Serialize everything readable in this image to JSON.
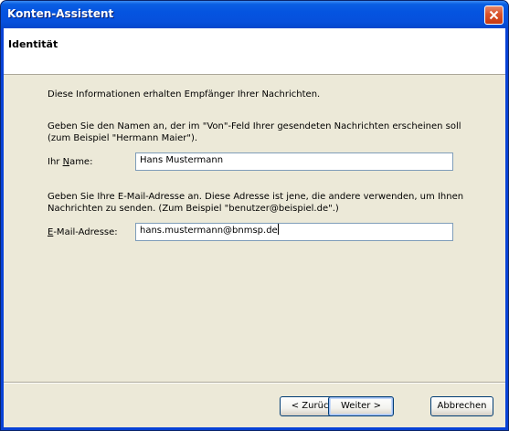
{
  "window": {
    "title": "Konten-Assistent",
    "close_icon": "close-icon"
  },
  "header": {
    "title": "Identität"
  },
  "content": {
    "intro": "Diese Informationen erhalten Empfänger Ihrer Nachrichten.",
    "name_instruction_line1": "Geben Sie den Namen an, der im \"Von\"-Feld Ihrer gesendeten Nachrichten erscheinen soll",
    "name_instruction_line2": "(zum Beispiel \"Hermann Maier\").",
    "name_label_pre": "Ihr ",
    "name_label_accel": "N",
    "name_label_post": "ame:",
    "name_value": "Hans Mustermann",
    "email_instruction_line1": "Geben Sie Ihre E-Mail-Adresse an. Diese Adresse ist jene, die andere verwenden, um Ihnen",
    "email_instruction_line2": "Nachrichten zu senden. (Zum Beispiel \"benutzer@beispiel.de\".)",
    "email_label_accel": "E",
    "email_label_post": "-Mail-Adresse:",
    "email_value": "hans.mustermann@bnmsp.de"
  },
  "buttons": {
    "back": "< Zurück",
    "next": "Weiter >",
    "cancel": "Abbrechen"
  },
  "colors": {
    "titlebar": "#0554e0",
    "client": "#ece9d8",
    "close_button": "#d9522a"
  }
}
